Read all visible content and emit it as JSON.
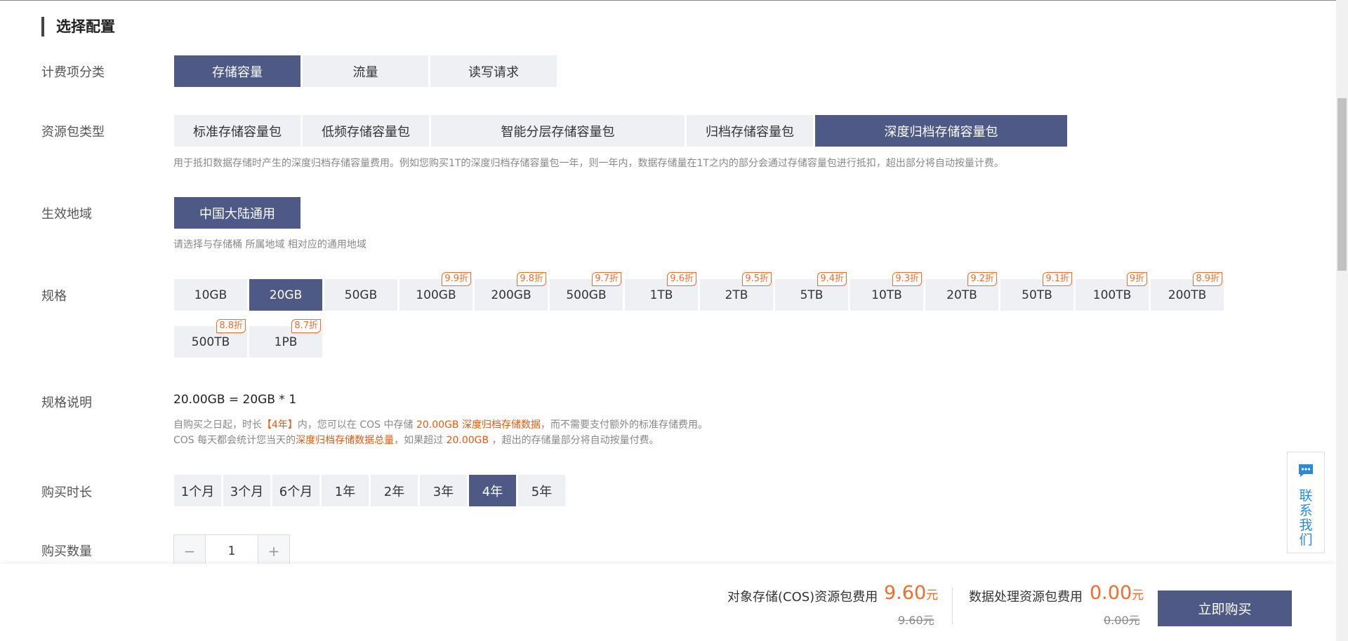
{
  "section_title": "选择配置",
  "billing": {
    "label": "计费项分类",
    "options": [
      "存储容量",
      "流量",
      "读写请求"
    ],
    "selected": 0
  },
  "package_type": {
    "label": "资源包类型",
    "options": [
      "标准存储容量包",
      "低频存储容量包",
      "智能分层存储容量包",
      "归档存储容量包",
      "深度归档存储容量包"
    ],
    "selected": 4,
    "hint": "用于抵扣数据存储时产生的深度归档存储容量费用。例如您购买1T的深度归档存储容量包一年，则一年内，数据存储量在1T之内的部分会通过存储容量包进行抵扣，超出部分将自动按量计费。"
  },
  "region": {
    "label": "生效地域",
    "options": [
      "中国大陆通用"
    ],
    "selected": 0,
    "hint": "请选择与存储桶 所属地域 相对应的通用地域"
  },
  "spec": {
    "label": "规格",
    "selected": 1,
    "options": [
      {
        "name": "10GB",
        "discount": ""
      },
      {
        "name": "20GB",
        "discount": ""
      },
      {
        "name": "50GB",
        "discount": ""
      },
      {
        "name": "100GB",
        "discount": "9.9折"
      },
      {
        "name": "200GB",
        "discount": "9.8折"
      },
      {
        "name": "500GB",
        "discount": "9.7折"
      },
      {
        "name": "1TB",
        "discount": "9.6折"
      },
      {
        "name": "2TB",
        "discount": "9.5折"
      },
      {
        "name": "5TB",
        "discount": "9.4折"
      },
      {
        "name": "10TB",
        "discount": "9.3折"
      },
      {
        "name": "20TB",
        "discount": "9.2折"
      },
      {
        "name": "50TB",
        "discount": "9.1折"
      },
      {
        "name": "100TB",
        "discount": "9折"
      },
      {
        "name": "200TB",
        "discount": "8.9折"
      },
      {
        "name": "500TB",
        "discount": "8.8折"
      },
      {
        "name": "1PB",
        "discount": "8.7折"
      }
    ]
  },
  "spec_desc": {
    "label": "规格说明",
    "formula": "20.00GB = 20GB * 1",
    "line1": {
      "a": "自购买之日起，时长",
      "b": "【4年】",
      "c": "内，您可以在 COS 中存储 ",
      "d": "20.00GB 深度归档存储数据",
      "e": "，而不需要支付额外的标准存储费用。"
    },
    "line2": {
      "a": "COS 每天都会统计您当天的",
      "b": "深度归档存储数据总量",
      "c": "，如果超过 ",
      "d": "20.00GB",
      "e": " ，超出的存储量部分将自动按量付费。"
    }
  },
  "duration": {
    "label": "购买时长",
    "options": [
      "1个月",
      "3个月",
      "6个月",
      "1年",
      "2年",
      "3年",
      "4年",
      "5年"
    ],
    "selected": 6
  },
  "quantity": {
    "label": "购买数量",
    "value": "1",
    "minus": "−",
    "plus": "+"
  },
  "contact": {
    "label": "联系我们",
    "icon": "chat-icon"
  },
  "footer": {
    "cos_label": "对象存储(COS)资源包费用",
    "cos_price": "9.60",
    "cos_orig": "9.60元",
    "proc_label": "数据处理资源包费用",
    "proc_price": "0.00",
    "proc_orig": "0.00元",
    "unit": "元",
    "buy_label": "立即购买"
  },
  "colors": {
    "accent": "#4e5a85",
    "highlight": "#f26d2b",
    "link": "#2b8ad8"
  }
}
